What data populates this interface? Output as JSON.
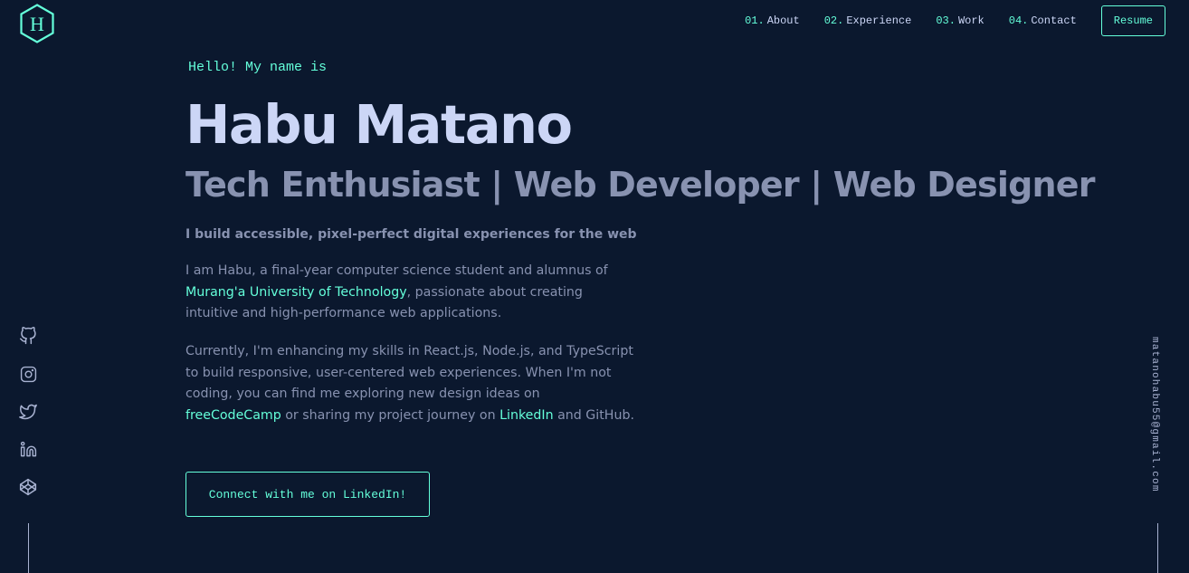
{
  "header": {
    "logo_letter": "H",
    "nav": [
      {
        "num": "01.",
        "label": "About"
      },
      {
        "num": "02.",
        "label": "Experience"
      },
      {
        "num": "03.",
        "label": "Work"
      },
      {
        "num": "04.",
        "label": "Contact"
      }
    ],
    "resume_label": "Resume"
  },
  "hero": {
    "greeting": "Hello! My name is",
    "name": "Habu Matano",
    "tagline": "Tech Enthusiast | Web Developer | Web Designer",
    "subhead": "I build accessible, pixel-perfect digital experiences for the web",
    "para1": {
      "l1": "I am Habu, a final-year computer science student and alumnus of",
      "link": "Murang'a University of Technology",
      "l2_rest": ", passionate about creating",
      "l3": "intuitive and high-performance web applications."
    },
    "para2": {
      "l1": "Currently, I'm enhancing my skills in React.js, Node.js, and TypeScript",
      "l2": "to build responsive, user-centered web experiences. When I'm not",
      "l3": "coding, you can find me exploring new design ideas on",
      "link1": "freeCodeCamp",
      "mid": " or sharing my project journey on ",
      "link2": "LinkedIn",
      "end": " and GitHub."
    },
    "cta_label": "Connect with me on LinkedIn!"
  },
  "social": {
    "icons": [
      "github-icon",
      "instagram-icon",
      "twitter-icon",
      "linkedin-icon",
      "codepen-icon"
    ]
  },
  "email": "matanohabu55@gmail.com",
  "colors": {
    "background": "#0b182e",
    "accent": "#64ffda",
    "heading": "#ccd6f6",
    "body": "#8892b0",
    "muted": "#a8b2d1"
  }
}
